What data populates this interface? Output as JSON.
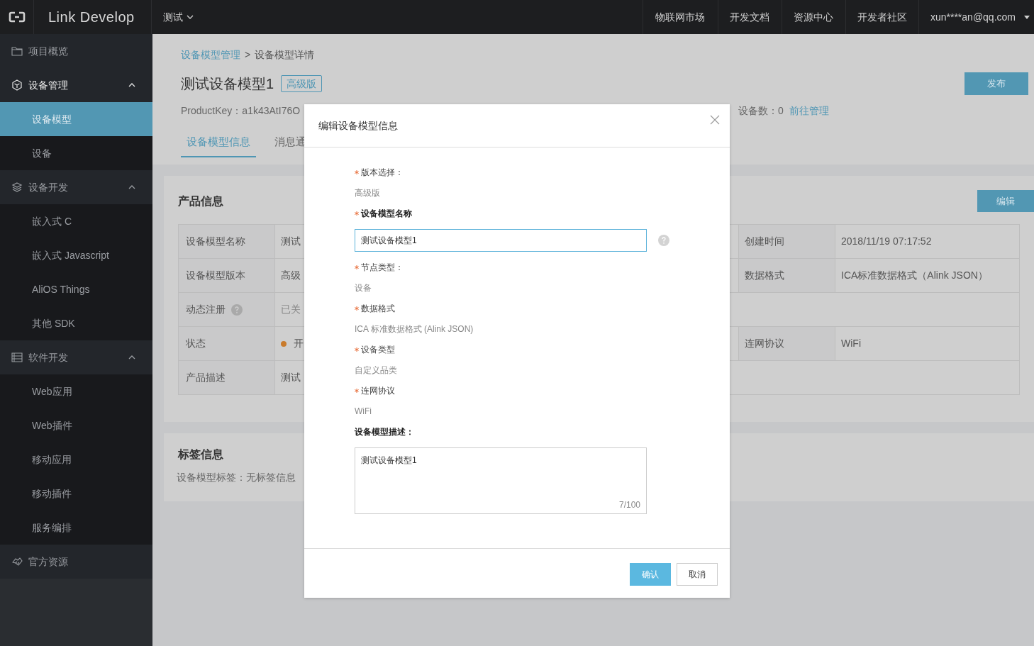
{
  "top_bar": {
    "brand": "Link Develop",
    "project": "测试",
    "links": [
      "物联网市场",
      "开发文档",
      "资源中心",
      "开发者社区"
    ],
    "user": "xun****an@qq.com"
  },
  "sidebar": {
    "groups": [
      {
        "label": "项目概览"
      },
      {
        "label": "设备管理",
        "expanded": true,
        "children": [
          {
            "label": "设备模型",
            "selected": true
          },
          {
            "label": "设备",
            "selected": false
          }
        ]
      },
      {
        "label": "设备开发",
        "expanded": true,
        "children": [
          {
            "label": "嵌入式 C",
            "selected": false
          },
          {
            "label": "嵌入式 Javascript",
            "selected": false
          },
          {
            "label": "AliOS Things",
            "selected": false
          },
          {
            "label": "其他 SDK",
            "selected": false
          }
        ]
      },
      {
        "label": "软件开发",
        "expanded": true,
        "children": [
          {
            "label": "Web应用",
            "selected": false
          },
          {
            "label": "Web插件",
            "selected": false
          },
          {
            "label": "移动应用",
            "selected": false
          },
          {
            "label": "移动插件",
            "selected": false
          },
          {
            "label": "服务编排",
            "selected": false
          }
        ]
      },
      {
        "label": "官方资源"
      }
    ]
  },
  "header": {
    "breadcrumb": [
      "设备模型管理",
      "设备模型详情"
    ],
    "separator": ">",
    "title": "测试设备模型1",
    "badge": "高级版",
    "publish_button": "发布",
    "product_key": "ProductKey：a1k43AtI76O",
    "device_count": "设备数：0",
    "manage_link": "前往管理",
    "tabs": [
      {
        "label": "设备模型信息",
        "selected": true
      },
      {
        "label": "消息通",
        "selected": false
      }
    ]
  },
  "product_info": {
    "title": "产品信息",
    "edit_button": "编辑",
    "rows": [
      {
        "label": "设备模型名称",
        "help": false,
        "value": "测试",
        "disabled": false,
        "right_label": "创建时间",
        "right_value": "2018/11/19 07:17:52"
      },
      {
        "label": "设备模型版本",
        "help": false,
        "value": "高级",
        "disabled": false,
        "right_label": "数据格式",
        "right_value": "ICA标准数据格式（Alink JSON）"
      },
      {
        "label": "动态注册",
        "help": true,
        "value": "已关",
        "disabled": true
      },
      {
        "label": "状态",
        "help": false,
        "value": "开",
        "disabled": false,
        "color": "#c97b2c",
        "right_label": "连网协议",
        "right_value": "WiFi"
      },
      {
        "label": "产品描述",
        "help": false,
        "value": "测试",
        "disabled": false
      }
    ]
  },
  "tag_info": {
    "title": "标签信息",
    "text": "设备模型标签：无标签信息"
  },
  "dialog": {
    "title": "编辑设备模型信息",
    "fields": [
      {
        "kind": "static",
        "required": true,
        "label": "版本选择：",
        "value": "高级版"
      },
      {
        "kind": "input",
        "required": true,
        "label": "设备模型名称",
        "value": "测试设备模型1"
      },
      {
        "kind": "static",
        "required": true,
        "label": "节点类型：",
        "value": "设备"
      },
      {
        "kind": "static",
        "required": true,
        "label": "数据格式",
        "value": "ICA 标准数据格式 (Alink JSON)"
      },
      {
        "kind": "static",
        "required": true,
        "label": "设备类型",
        "value": "自定义品类"
      },
      {
        "kind": "static",
        "required": true,
        "label": "连网协议",
        "value": "WiFi"
      },
      {
        "kind": "textarea",
        "required": false,
        "label": "设备模型描述：",
        "value": "测试设备模型1",
        "counter": "7/100"
      }
    ],
    "buttons": [
      {
        "label": "确认",
        "kind": "primary"
      },
      {
        "label": "取消",
        "kind": "default"
      }
    ]
  }
}
